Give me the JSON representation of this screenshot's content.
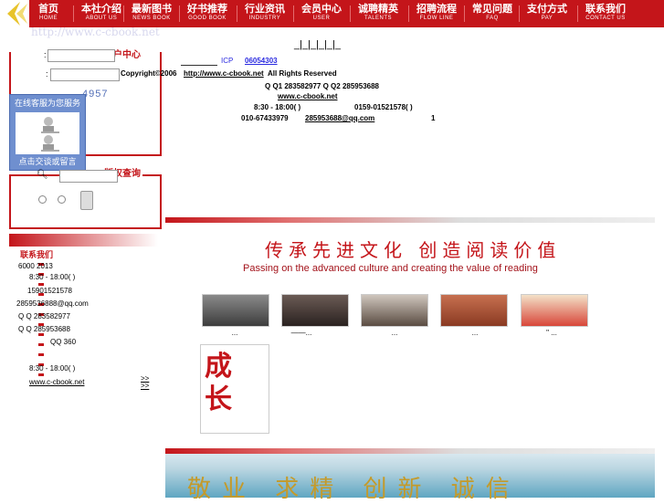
{
  "nav": {
    "items": [
      {
        "zh": "首页",
        "en": "HOME"
      },
      {
        "zh": "本社介绍",
        "en": "ABOUT US"
      },
      {
        "zh": "最新图书",
        "en": "NEWS BOOK"
      },
      {
        "zh": "好书推荐",
        "en": "GOOD BOOK"
      },
      {
        "zh": "行业资讯",
        "en": "INDUSTRY"
      },
      {
        "zh": "会员中心",
        "en": "USER"
      },
      {
        "zh": "诚聘精英",
        "en": "TALENTS"
      },
      {
        "zh": "招聘流程",
        "en": "FLOW LINE"
      },
      {
        "zh": "常见问题",
        "en": "FAQ"
      },
      {
        "zh": "支付方式",
        "en": "PAY"
      },
      {
        "zh": "联系我们",
        "en": "CONTACT US"
      }
    ]
  },
  "logo_url": "http://www.c-cbook.net",
  "sublinks": "_|_|_|_|_|_",
  "user_center": {
    "title": "用户中心",
    "label1": ":",
    "label2": ":",
    "digits": "4957"
  },
  "service": {
    "title": "在线客服为您服务",
    "button": "点击交谈或留言"
  },
  "search": {
    "title": "版权查询"
  },
  "left_section": {
    "title": "联系我们",
    "lines": [
      "6000 2013",
      "8:30 - 18:00( )",
      "15901521578",
      "2859536888@qq.com",
      "Q Q 283582977",
      "Q Q 285953688",
      "QQ 360",
      "8:30 - 18:00( )"
    ],
    "link": "www.c-cbook.net",
    "more1": ">>",
    "more2": ">>"
  },
  "footer": {
    "icp_label": "ICP",
    "icp_num": "06054303",
    "copyright": "Copyright©2006",
    "copyright_link": "http://www.c-cbook.net",
    "rights": "All Rights Reserved",
    "qq_line": "Q Q1 283582977    Q Q2 285953688",
    "site": "www.c-cbook.net",
    "hours": "8:30 - 18:00(      )",
    "mobile": "0159-01521578(     )",
    "tel": "010-67433979",
    "email": "285953688@qq.com",
    "one": "1"
  },
  "banner": {
    "slogan_zh": "传承先进文化 创造阅读价值",
    "slogan_en": "Passing on the advanced culture and creating the value of reading",
    "motto": "敬业 求精 创新 诚信"
  },
  "books": {
    "captions": [
      "...",
      "——...",
      "...",
      "...",
      "\" ..."
    ],
    "feature_title": "成长"
  },
  "colors": {
    "brand_red": "#c4151a",
    "service_blue": "#6f8fcf"
  }
}
